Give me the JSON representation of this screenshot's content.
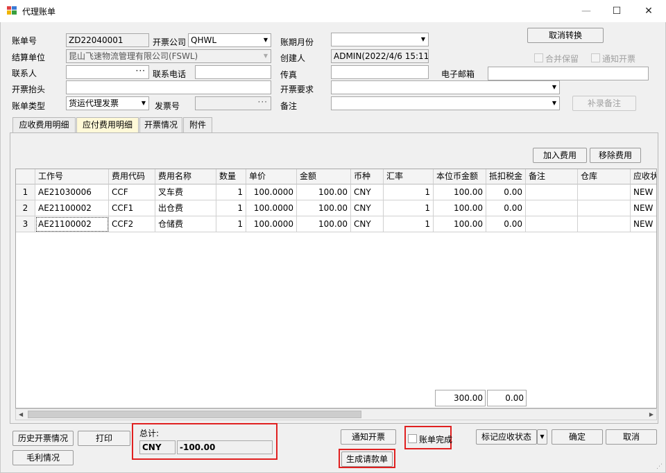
{
  "window": {
    "title": "代理账单",
    "minimize": "—",
    "maximize": "☐",
    "close": "✕"
  },
  "form": {
    "bill_no_label": "账单号",
    "bill_no": "ZD22040001",
    "invoice_company_label": "开票公司",
    "invoice_company": "QHWL",
    "period_label": "账期月份",
    "period": "",
    "settle_unit_label": "结算单位",
    "settle_unit": "昆山飞速物流管理有限公司(FSWL)",
    "creator_label": "创建人",
    "creator": "ADMIN(2022/4/6 15:11:",
    "contact_label": "联系人",
    "contact": "",
    "phone_label": "联系电话",
    "phone": "",
    "fax_label": "传真",
    "fax": "",
    "email_label": "电子邮箱",
    "email": "",
    "invoice_header_label": "开票抬头",
    "invoice_header": "",
    "invoice_req_label": "开票要求",
    "invoice_req": "",
    "bill_type_label": "账单类型",
    "bill_type": "货运代理发票",
    "invoice_no_label": "发票号",
    "invoice_no": "",
    "remark_label": "备注",
    "remark": "",
    "cancel_convert": "取消转换",
    "merge_reserve": "合并保留",
    "notify_invoice": "通知开票",
    "supplement_remark": "补录备注"
  },
  "tabs": [
    "应收费用明细",
    "应付费用明细",
    "开票情况",
    "附件"
  ],
  "grid_buttons": {
    "add": "加入费用",
    "remove": "移除费用"
  },
  "grid": {
    "headers": [
      "",
      "工作号",
      "费用代码",
      "费用名称",
      "数量",
      "单价",
      "金额",
      "币种",
      "汇率",
      "本位币金额",
      "抵扣税金",
      "备注",
      "仓库",
      "应收状"
    ],
    "rows": [
      [
        "1",
        "AE21030006",
        "CCF",
        "叉车费",
        "1",
        "100.0000",
        "100.00",
        "CNY",
        "1",
        "100.00",
        "0.00",
        "",
        "",
        "NEW"
      ],
      [
        "2",
        "AE21100002",
        "CCF1",
        "出仓费",
        "1",
        "100.0000",
        "100.00",
        "CNY",
        "1",
        "100.00",
        "0.00",
        "",
        "",
        "NEW"
      ],
      [
        "3",
        "AE21100002",
        "CCF2",
        "仓储费",
        "1",
        "100.0000",
        "100.00",
        "CNY",
        "1",
        "100.00",
        "0.00",
        "",
        "",
        "NEW"
      ]
    ],
    "total_amount": "300.00",
    "total_tax": "0.00"
  },
  "footer": {
    "history_invoice": "历史开票情况",
    "print": "打印",
    "gross_profit": "毛利情况",
    "total_label": "总计:",
    "total_currency": "CNY",
    "total_value": "-100.00",
    "notify_invoice_btn": "通知开票",
    "generate_payment": "生成请款单",
    "bill_complete": "账单完成",
    "mark_receivable": "标记应收状态",
    "ok": "确定",
    "cancel": "取消"
  },
  "colors": {
    "highlight": "#e02020",
    "active_tab": "#fff9d8"
  }
}
